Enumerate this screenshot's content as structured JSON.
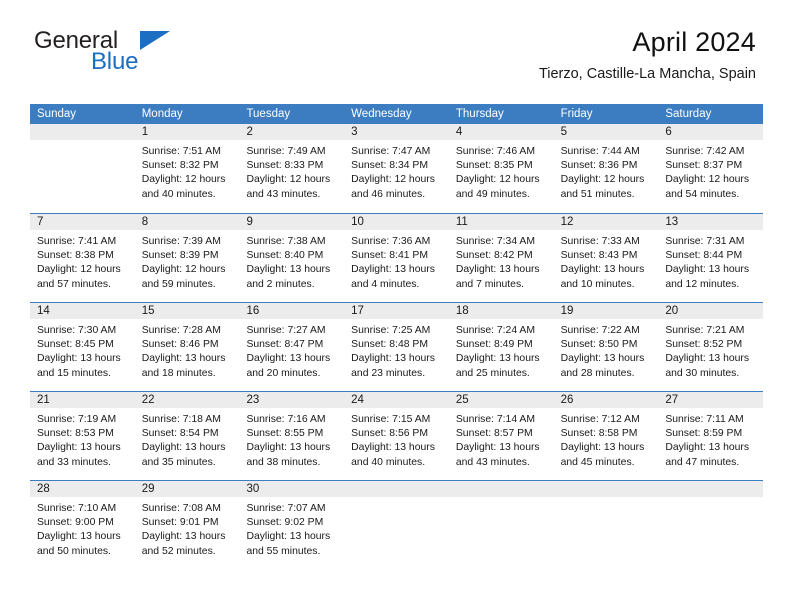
{
  "brand": {
    "name_part1": "General",
    "name_part2": "Blue",
    "flag_icon": "blue-triangle-flag",
    "primary_color": "#1b6ec2"
  },
  "header": {
    "title": "April 2024",
    "subtitle": "Tierzo, Castille-La Mancha, Spain"
  },
  "calendar": {
    "header_color": "#3b7dc0",
    "daynum_band_color": "#ececec",
    "weekdays": [
      "Sunday",
      "Monday",
      "Tuesday",
      "Wednesday",
      "Thursday",
      "Friday",
      "Saturday"
    ],
    "weeks": [
      [
        {
          "day": "",
          "empty": true
        },
        {
          "day": "1",
          "sunrise": "Sunrise: 7:51 AM",
          "sunset": "Sunset: 8:32 PM",
          "daylight": "Daylight: 12 hours and 40 minutes."
        },
        {
          "day": "2",
          "sunrise": "Sunrise: 7:49 AM",
          "sunset": "Sunset: 8:33 PM",
          "daylight": "Daylight: 12 hours and 43 minutes."
        },
        {
          "day": "3",
          "sunrise": "Sunrise: 7:47 AM",
          "sunset": "Sunset: 8:34 PM",
          "daylight": "Daylight: 12 hours and 46 minutes."
        },
        {
          "day": "4",
          "sunrise": "Sunrise: 7:46 AM",
          "sunset": "Sunset: 8:35 PM",
          "daylight": "Daylight: 12 hours and 49 minutes."
        },
        {
          "day": "5",
          "sunrise": "Sunrise: 7:44 AM",
          "sunset": "Sunset: 8:36 PM",
          "daylight": "Daylight: 12 hours and 51 minutes."
        },
        {
          "day": "6",
          "sunrise": "Sunrise: 7:42 AM",
          "sunset": "Sunset: 8:37 PM",
          "daylight": "Daylight: 12 hours and 54 minutes."
        }
      ],
      [
        {
          "day": "7",
          "sunrise": "Sunrise: 7:41 AM",
          "sunset": "Sunset: 8:38 PM",
          "daylight": "Daylight: 12 hours and 57 minutes."
        },
        {
          "day": "8",
          "sunrise": "Sunrise: 7:39 AM",
          "sunset": "Sunset: 8:39 PM",
          "daylight": "Daylight: 12 hours and 59 minutes."
        },
        {
          "day": "9",
          "sunrise": "Sunrise: 7:38 AM",
          "sunset": "Sunset: 8:40 PM",
          "daylight": "Daylight: 13 hours and 2 minutes."
        },
        {
          "day": "10",
          "sunrise": "Sunrise: 7:36 AM",
          "sunset": "Sunset: 8:41 PM",
          "daylight": "Daylight: 13 hours and 4 minutes."
        },
        {
          "day": "11",
          "sunrise": "Sunrise: 7:34 AM",
          "sunset": "Sunset: 8:42 PM",
          "daylight": "Daylight: 13 hours and 7 minutes."
        },
        {
          "day": "12",
          "sunrise": "Sunrise: 7:33 AM",
          "sunset": "Sunset: 8:43 PM",
          "daylight": "Daylight: 13 hours and 10 minutes."
        },
        {
          "day": "13",
          "sunrise": "Sunrise: 7:31 AM",
          "sunset": "Sunset: 8:44 PM",
          "daylight": "Daylight: 13 hours and 12 minutes."
        }
      ],
      [
        {
          "day": "14",
          "sunrise": "Sunrise: 7:30 AM",
          "sunset": "Sunset: 8:45 PM",
          "daylight": "Daylight: 13 hours and 15 minutes."
        },
        {
          "day": "15",
          "sunrise": "Sunrise: 7:28 AM",
          "sunset": "Sunset: 8:46 PM",
          "daylight": "Daylight: 13 hours and 18 minutes."
        },
        {
          "day": "16",
          "sunrise": "Sunrise: 7:27 AM",
          "sunset": "Sunset: 8:47 PM",
          "daylight": "Daylight: 13 hours and 20 minutes."
        },
        {
          "day": "17",
          "sunrise": "Sunrise: 7:25 AM",
          "sunset": "Sunset: 8:48 PM",
          "daylight": "Daylight: 13 hours and 23 minutes."
        },
        {
          "day": "18",
          "sunrise": "Sunrise: 7:24 AM",
          "sunset": "Sunset: 8:49 PM",
          "daylight": "Daylight: 13 hours and 25 minutes."
        },
        {
          "day": "19",
          "sunrise": "Sunrise: 7:22 AM",
          "sunset": "Sunset: 8:50 PM",
          "daylight": "Daylight: 13 hours and 28 minutes."
        },
        {
          "day": "20",
          "sunrise": "Sunrise: 7:21 AM",
          "sunset": "Sunset: 8:52 PM",
          "daylight": "Daylight: 13 hours and 30 minutes."
        }
      ],
      [
        {
          "day": "21",
          "sunrise": "Sunrise: 7:19 AM",
          "sunset": "Sunset: 8:53 PM",
          "daylight": "Daylight: 13 hours and 33 minutes."
        },
        {
          "day": "22",
          "sunrise": "Sunrise: 7:18 AM",
          "sunset": "Sunset: 8:54 PM",
          "daylight": "Daylight: 13 hours and 35 minutes."
        },
        {
          "day": "23",
          "sunrise": "Sunrise: 7:16 AM",
          "sunset": "Sunset: 8:55 PM",
          "daylight": "Daylight: 13 hours and 38 minutes."
        },
        {
          "day": "24",
          "sunrise": "Sunrise: 7:15 AM",
          "sunset": "Sunset: 8:56 PM",
          "daylight": "Daylight: 13 hours and 40 minutes."
        },
        {
          "day": "25",
          "sunrise": "Sunrise: 7:14 AM",
          "sunset": "Sunset: 8:57 PM",
          "daylight": "Daylight: 13 hours and 43 minutes."
        },
        {
          "day": "26",
          "sunrise": "Sunrise: 7:12 AM",
          "sunset": "Sunset: 8:58 PM",
          "daylight": "Daylight: 13 hours and 45 minutes."
        },
        {
          "day": "27",
          "sunrise": "Sunrise: 7:11 AM",
          "sunset": "Sunset: 8:59 PM",
          "daylight": "Daylight: 13 hours and 47 minutes."
        }
      ],
      [
        {
          "day": "28",
          "sunrise": "Sunrise: 7:10 AM",
          "sunset": "Sunset: 9:00 PM",
          "daylight": "Daylight: 13 hours and 50 minutes."
        },
        {
          "day": "29",
          "sunrise": "Sunrise: 7:08 AM",
          "sunset": "Sunset: 9:01 PM",
          "daylight": "Daylight: 13 hours and 52 minutes."
        },
        {
          "day": "30",
          "sunrise": "Sunrise: 7:07 AM",
          "sunset": "Sunset: 9:02 PM",
          "daylight": "Daylight: 13 hours and 55 minutes."
        },
        {
          "day": "",
          "empty": true
        },
        {
          "day": "",
          "empty": true
        },
        {
          "day": "",
          "empty": true
        },
        {
          "day": "",
          "empty": true
        }
      ]
    ]
  }
}
